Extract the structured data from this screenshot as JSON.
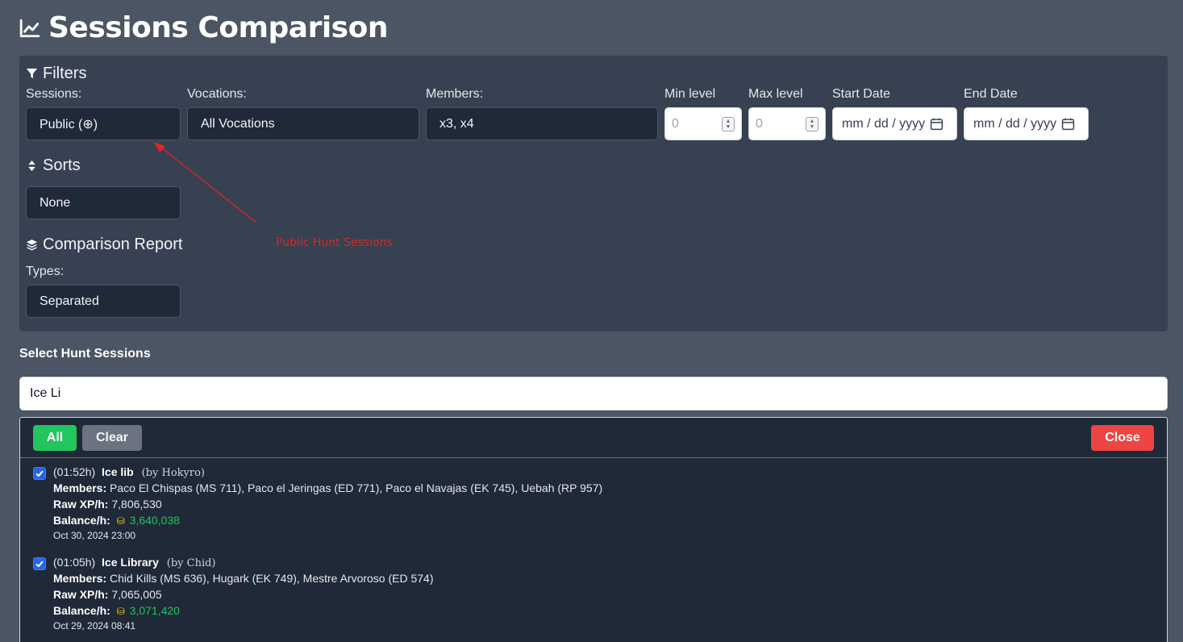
{
  "page": {
    "title": "Sessions Comparison",
    "title_icon": "chart-line-icon"
  },
  "filters": {
    "heading": "Filters",
    "sessions": {
      "label": "Sessions:",
      "value": "Public (⊕)"
    },
    "vocations": {
      "label": "Vocations:",
      "value": "All Vocations"
    },
    "members": {
      "label": "Members:",
      "value": "x3, x4"
    },
    "min_level": {
      "label": "Min level",
      "placeholder": "0"
    },
    "max_level": {
      "label": "Max level",
      "placeholder": "0"
    },
    "start_date": {
      "label": "Start Date",
      "placeholder": "mm / dd / yyyy"
    },
    "end_date": {
      "label": "End Date",
      "placeholder": "mm / dd / yyyy"
    }
  },
  "sorts": {
    "heading": "Sorts",
    "value": "None"
  },
  "comparison_report": {
    "heading": "Comparison Report",
    "types_label": "Types:",
    "types_value": "Separated"
  },
  "annotation": {
    "text": "Public Hunt Sessions",
    "color": "#dc2626"
  },
  "hunt_sessions": {
    "label": "Select Hunt Sessions",
    "search_value": "Ice Li",
    "buttons": {
      "all": "All",
      "clear": "Clear",
      "close": "Close"
    },
    "items": [
      {
        "checked": true,
        "duration": "(01:52h)",
        "name": "Ice lib",
        "by": "(by Hokyro)",
        "members_label": "Members:",
        "members": "Paco El Chispas (MS 711), Paco el Jeringas (ED 771), Paco el Navajas (EK 745), Uebah (RP 957)",
        "rawxp_label": "Raw XP/h:",
        "rawxp": "7,806,530",
        "balance_label": "Balance/h:",
        "balance": "3,640,038",
        "date": "Oct 30, 2024 23:00"
      },
      {
        "checked": true,
        "duration": "(01:05h)",
        "name": "Ice Library",
        "by": "(by Chid)",
        "members_label": "Members:",
        "members": "Chid Kills (MS 636), Hugark (EK 749), Mestre Arvoroso (ED 574)",
        "rawxp_label": "Raw XP/h:",
        "rawxp": "7,065,005",
        "balance_label": "Balance/h:",
        "balance": "3,071,420",
        "date": "Oct 29, 2024 08:41"
      }
    ]
  },
  "colors": {
    "background": "#4b5563",
    "panel": "#374151",
    "input_dark": "#1f2937",
    "btn_all": "#22c55e",
    "btn_clear": "#6b7280",
    "btn_close": "#ef4444",
    "balance": "#22c55e"
  }
}
